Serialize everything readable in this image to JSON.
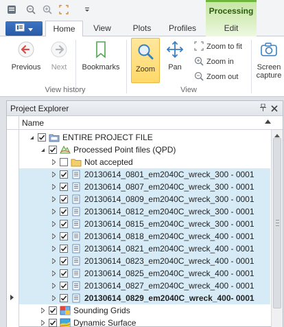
{
  "quick_access": {
    "icons": [
      "app-menu-icon",
      "zoom-out-icon",
      "zoom-in-icon",
      "fullscreen-icon",
      "customize-icon"
    ]
  },
  "context_tab": {
    "title": "Processing"
  },
  "file_button": {
    "icon": "document-icon"
  },
  "tabs": [
    {
      "label": "Home",
      "active": true
    },
    {
      "label": "View",
      "active": false
    },
    {
      "label": "Plots",
      "active": false
    },
    {
      "label": "Profiles",
      "active": false
    },
    {
      "label": "Edit",
      "active": false,
      "contextual": true
    }
  ],
  "ribbon": {
    "groups": {
      "view_history": "View history",
      "view": "View"
    },
    "buttons": {
      "previous": "Previous",
      "next": "Next",
      "bookmarks": "Bookmarks",
      "zoom": "Zoom",
      "pan": "Pan",
      "zoom_to_fit": "Zoom to fit",
      "zoom_in": "Zoom in",
      "zoom_out": "Zoom out",
      "screen_capture": "Screen capture"
    },
    "screen_capture_line1": "Screen",
    "screen_capture_line2": "capture"
  },
  "panel": {
    "title": "Project Explorer",
    "pin_icon": "pin-icon",
    "close_icon": "close-icon",
    "column_header": "Name"
  },
  "tree": [
    {
      "label": "ENTIRE PROJECT FILE",
      "level": 0,
      "expander": "collapse",
      "checked": true,
      "icon": "project-folder-icon",
      "highlight": false
    },
    {
      "label": "Processed Point files (QPD)",
      "level": 1,
      "expander": "collapse",
      "checked": true,
      "icon": "point-files-icon",
      "highlight": false
    },
    {
      "label": "Not accepted",
      "level": 2,
      "expander": "expand",
      "checked": false,
      "icon": "folder-icon",
      "highlight": false
    },
    {
      "label": "20130614_0801_em2040C_wreck_300 - 0001",
      "level": 2,
      "expander": "expand",
      "checked": true,
      "icon": "qpd-file-icon",
      "highlight": true
    },
    {
      "label": "20130614_0807_em2040C_wreck_300 - 0001",
      "level": 2,
      "expander": "expand",
      "checked": true,
      "icon": "qpd-file-icon",
      "highlight": true
    },
    {
      "label": "20130614_0809_em2040C_wreck_300 - 0001",
      "level": 2,
      "expander": "expand",
      "checked": true,
      "icon": "qpd-file-icon",
      "highlight": true
    },
    {
      "label": "20130614_0812_em2040C_wreck_300 - 0001",
      "level": 2,
      "expander": "expand",
      "checked": true,
      "icon": "qpd-file-icon",
      "highlight": true
    },
    {
      "label": "20130614_0815_em2040C_wreck_300 - 0001",
      "level": 2,
      "expander": "expand",
      "checked": true,
      "icon": "qpd-file-icon",
      "highlight": true
    },
    {
      "label": "20130614_0818_em2040C_wreck_400 - 0001",
      "level": 2,
      "expander": "expand",
      "checked": true,
      "icon": "qpd-file-icon",
      "highlight": true
    },
    {
      "label": "20130614_0821_em2040C_wreck_400 - 0001",
      "level": 2,
      "expander": "expand",
      "checked": true,
      "icon": "qpd-file-icon",
      "highlight": true
    },
    {
      "label": "20130614_0823_em2040C_wreck_400 - 0001",
      "level": 2,
      "expander": "expand",
      "checked": true,
      "icon": "qpd-file-icon",
      "highlight": true
    },
    {
      "label": "20130614_0825_em2040C_wreck_400 - 0001",
      "level": 2,
      "expander": "expand",
      "checked": true,
      "icon": "qpd-file-icon",
      "highlight": true
    },
    {
      "label": "20130614_0827_em2040C_wreck_400 - 0001",
      "level": 2,
      "expander": "expand",
      "checked": true,
      "icon": "qpd-file-icon",
      "highlight": true
    },
    {
      "label": "20130614_0829_em2040C_wreck_400- 0001",
      "level": 2,
      "expander": "expand",
      "checked": true,
      "icon": "qpd-file-icon",
      "highlight": true,
      "bold": true,
      "current": true
    },
    {
      "label": "Sounding Grids",
      "level": 1,
      "expander": "expand",
      "checked": true,
      "icon": "grid-icon",
      "highlight": false
    },
    {
      "label": "Dynamic Surface",
      "level": 1,
      "expander": "expand",
      "checked": true,
      "icon": "surface-icon",
      "highlight": false
    }
  ],
  "colors": {
    "accent_blue": "#2a5aa6",
    "context_green": "#6fb73c",
    "selection": "#d7ebf7",
    "zoom_selected": "#ffd869"
  }
}
